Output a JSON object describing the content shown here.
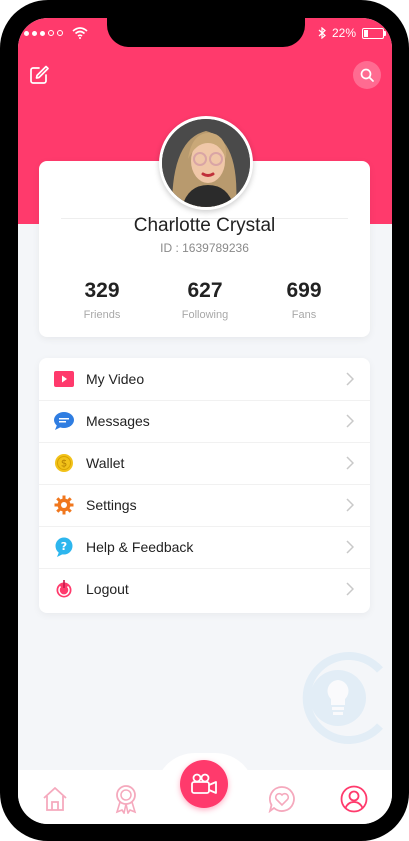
{
  "status_bar": {
    "battery": "22%",
    "battery_level": 0.22
  },
  "profile": {
    "name": "Charlotte Crystal",
    "id_text": "ID : 1639789236",
    "stats": [
      {
        "value": "329",
        "label": "Friends"
      },
      {
        "value": "627",
        "label": "Following"
      },
      {
        "value": "699",
        "label": "Fans"
      }
    ]
  },
  "menu": [
    {
      "label": "My Video",
      "icon": "video-icon",
      "color": "#ff3a6c"
    },
    {
      "label": "Messages",
      "icon": "chat-bubble-icon",
      "color": "#2f7de1"
    },
    {
      "label": "Wallet",
      "icon": "coin-icon",
      "color": "#f2c21a"
    },
    {
      "label": "Settings",
      "icon": "gear-icon",
      "color": "#f0771e"
    },
    {
      "label": "Help & Feedback",
      "icon": "question-icon",
      "color": "#2db6ee"
    },
    {
      "label": "Logout",
      "icon": "power-icon",
      "color": "#ff3a6c"
    }
  ],
  "tabbar": [
    {
      "name": "home",
      "icon": "home-icon"
    },
    {
      "name": "badge",
      "icon": "award-icon"
    },
    {
      "name": "camera",
      "icon": "video-camera-icon"
    },
    {
      "name": "favorites",
      "icon": "heart-chat-icon"
    },
    {
      "name": "profile",
      "icon": "user-icon"
    }
  ],
  "colors": {
    "accent": "#ff3a6c",
    "background": "#f4f6f9",
    "tab_inactive": "#f5a9bd"
  }
}
